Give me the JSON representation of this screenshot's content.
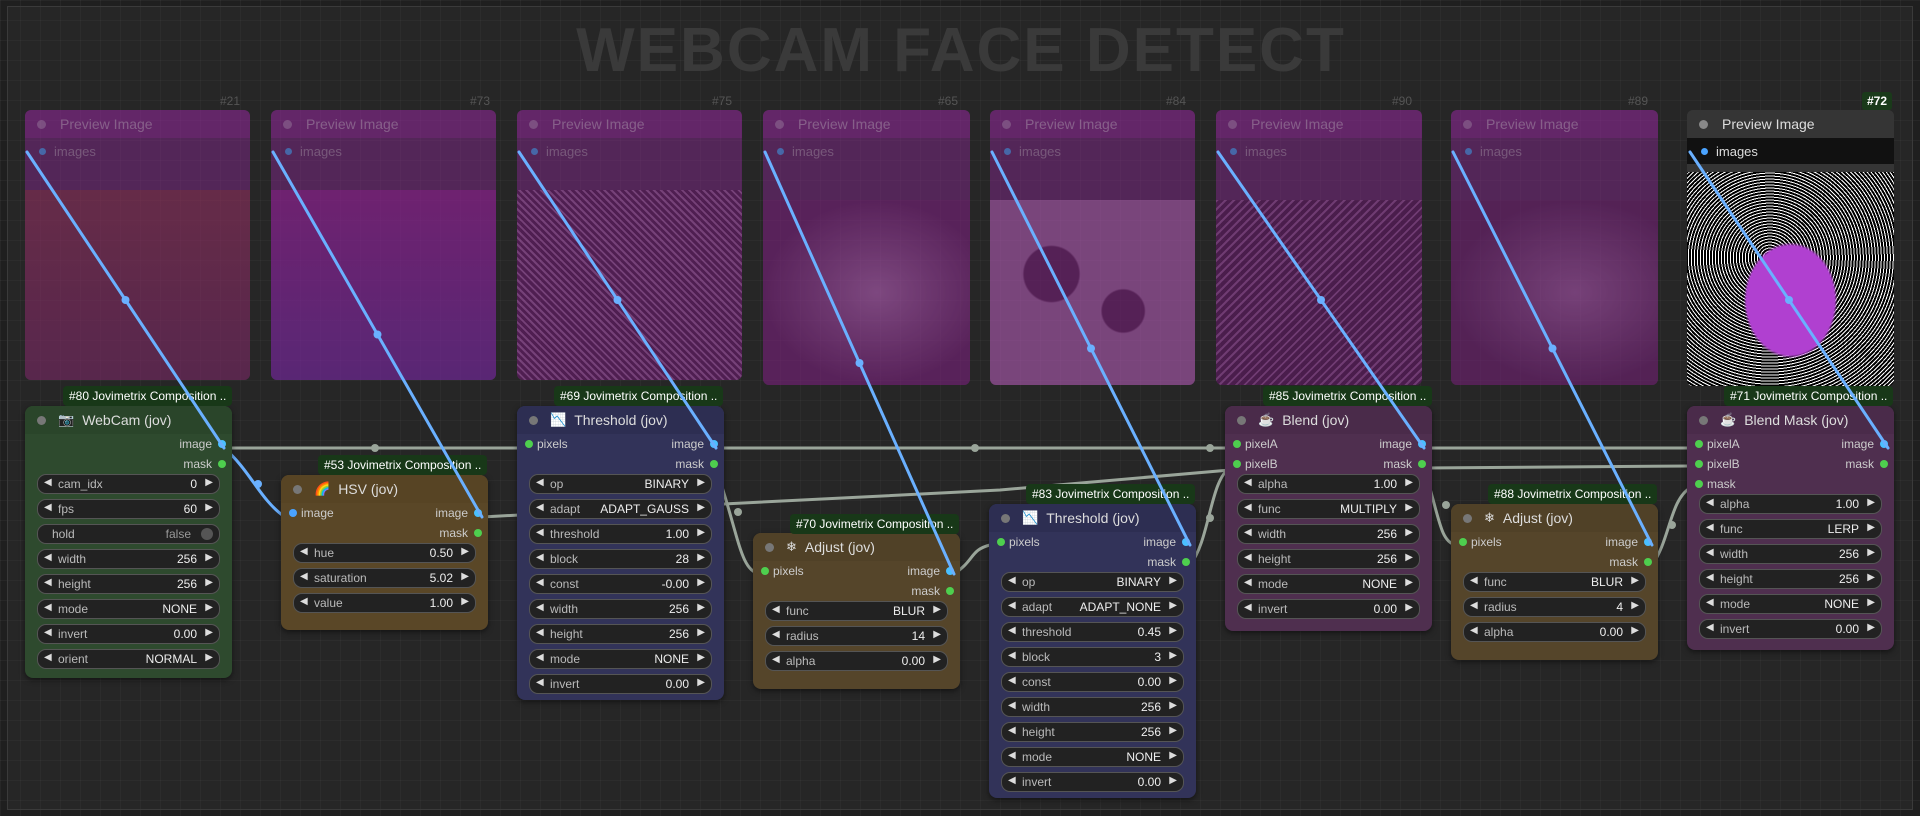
{
  "group_title": "WEBCAM FACE DETECT",
  "previews": [
    {
      "id": "#21",
      "title": "Preview Image",
      "input": "images"
    },
    {
      "id": "#73",
      "title": "Preview Image",
      "input": "images"
    },
    {
      "id": "#75",
      "title": "Preview Image",
      "input": "images"
    },
    {
      "id": "#65",
      "title": "Preview Image",
      "input": "images"
    },
    {
      "id": "#84",
      "title": "Preview Image",
      "input": "images"
    },
    {
      "id": "#90",
      "title": "Preview Image",
      "input": "images"
    },
    {
      "id": "#89",
      "title": "Preview Image",
      "input": "images"
    },
    {
      "id": "#72",
      "title": "Preview Image",
      "input": "images"
    }
  ],
  "nodes": {
    "webcam": {
      "badge": "#80 Jovimetrix Composition ..",
      "title": "WebCam (jov)",
      "outputs": [
        "image",
        "mask"
      ],
      "widgets": [
        {
          "label": "cam_idx",
          "value": "0"
        },
        {
          "label": "fps",
          "value": "60"
        },
        {
          "label": "hold",
          "value": "false"
        },
        {
          "label": "width",
          "value": "256"
        },
        {
          "label": "height",
          "value": "256"
        },
        {
          "label": "mode",
          "value": "NONE"
        },
        {
          "label": "invert",
          "value": "0.00"
        },
        {
          "label": "orient",
          "value": "NORMAL"
        }
      ]
    },
    "hsv": {
      "badge": "#53 Jovimetrix Composition ..",
      "title": "HSV (jov)",
      "input": "image",
      "outputs": [
        "image",
        "mask"
      ],
      "widgets": [
        {
          "label": "hue",
          "value": "0.50"
        },
        {
          "label": "saturation",
          "value": "5.02"
        },
        {
          "label": "value",
          "value": "1.00"
        }
      ]
    },
    "threshold1": {
      "badge": "#69 Jovimetrix Composition ..",
      "title": "Threshold (jov)",
      "input": "pixels",
      "outputs": [
        "image",
        "mask"
      ],
      "widgets": [
        {
          "label": "op",
          "value": "BINARY"
        },
        {
          "label": "adapt",
          "value": "ADAPT_GAUSS"
        },
        {
          "label": "threshold",
          "value": "1.00"
        },
        {
          "label": "block",
          "value": "28"
        },
        {
          "label": "const",
          "value": "-0.00"
        },
        {
          "label": "width",
          "value": "256"
        },
        {
          "label": "height",
          "value": "256"
        },
        {
          "label": "mode",
          "value": "NONE"
        },
        {
          "label": "invert",
          "value": "0.00"
        }
      ]
    },
    "adjust1": {
      "badge": "#70 Jovimetrix Composition ..",
      "title": "Adjust (jov)",
      "input": "pixels",
      "outputs": [
        "image",
        "mask"
      ],
      "widgets": [
        {
          "label": "func",
          "value": "BLUR"
        },
        {
          "label": "radius",
          "value": "14"
        },
        {
          "label": "alpha",
          "value": "0.00"
        }
      ]
    },
    "threshold2": {
      "badge": "#83 Jovimetrix Composition ..",
      "title": "Threshold (jov)",
      "input": "pixels",
      "outputs": [
        "image",
        "mask"
      ],
      "widgets": [
        {
          "label": "op",
          "value": "BINARY"
        },
        {
          "label": "adapt",
          "value": "ADAPT_NONE"
        },
        {
          "label": "threshold",
          "value": "0.45"
        },
        {
          "label": "block",
          "value": "3"
        },
        {
          "label": "const",
          "value": "0.00"
        },
        {
          "label": "width",
          "value": "256"
        },
        {
          "label": "height",
          "value": "256"
        },
        {
          "label": "mode",
          "value": "NONE"
        },
        {
          "label": "invert",
          "value": "0.00"
        }
      ]
    },
    "blend": {
      "badge": "#85 Jovimetrix Composition ..",
      "title": "Blend (jov)",
      "inputs": [
        "pixelA",
        "pixelB"
      ],
      "outputs": [
        "image",
        "mask"
      ],
      "widgets": [
        {
          "label": "alpha",
          "value": "1.00"
        },
        {
          "label": "func",
          "value": "MULTIPLY"
        },
        {
          "label": "width",
          "value": "256"
        },
        {
          "label": "height",
          "value": "256"
        },
        {
          "label": "mode",
          "value": "NONE"
        },
        {
          "label": "invert",
          "value": "0.00"
        }
      ]
    },
    "adjust2": {
      "badge": "#88 Jovimetrix Composition ..",
      "title": "Adjust (jov)",
      "input": "pixels",
      "outputs": [
        "image",
        "mask"
      ],
      "widgets": [
        {
          "label": "func",
          "value": "BLUR"
        },
        {
          "label": "radius",
          "value": "4"
        },
        {
          "label": "alpha",
          "value": "0.00"
        }
      ]
    },
    "blendmask": {
      "badge": "#71 Jovimetrix Composition ..",
      "title": "Blend Mask (jov)",
      "inputs": [
        "pixelA",
        "pixelB",
        "mask"
      ],
      "outputs": [
        "image",
        "mask"
      ],
      "widgets": [
        {
          "label": "alpha",
          "value": "1.00"
        },
        {
          "label": "func",
          "value": "LERP"
        },
        {
          "label": "width",
          "value": "256"
        },
        {
          "label": "height",
          "value": "256"
        },
        {
          "label": "mode",
          "value": "NONE"
        },
        {
          "label": "invert",
          "value": "0.00"
        }
      ]
    }
  },
  "colors": {
    "webcam": "#2d4a2d",
    "hsv": "#5e4a28",
    "threshold": "#32335a",
    "adjust": "#55462a",
    "blend": "#4f2f4f",
    "preview": "#8a2a96",
    "wire_image": "#6ab0ff",
    "wire_gray": "#aab0a8"
  },
  "icons": {
    "webcam": "camera-icon",
    "hsv": "rainbow-icon",
    "threshold": "threshold-icon",
    "adjust": "snowflake-icon",
    "blend": "cup-icon"
  }
}
